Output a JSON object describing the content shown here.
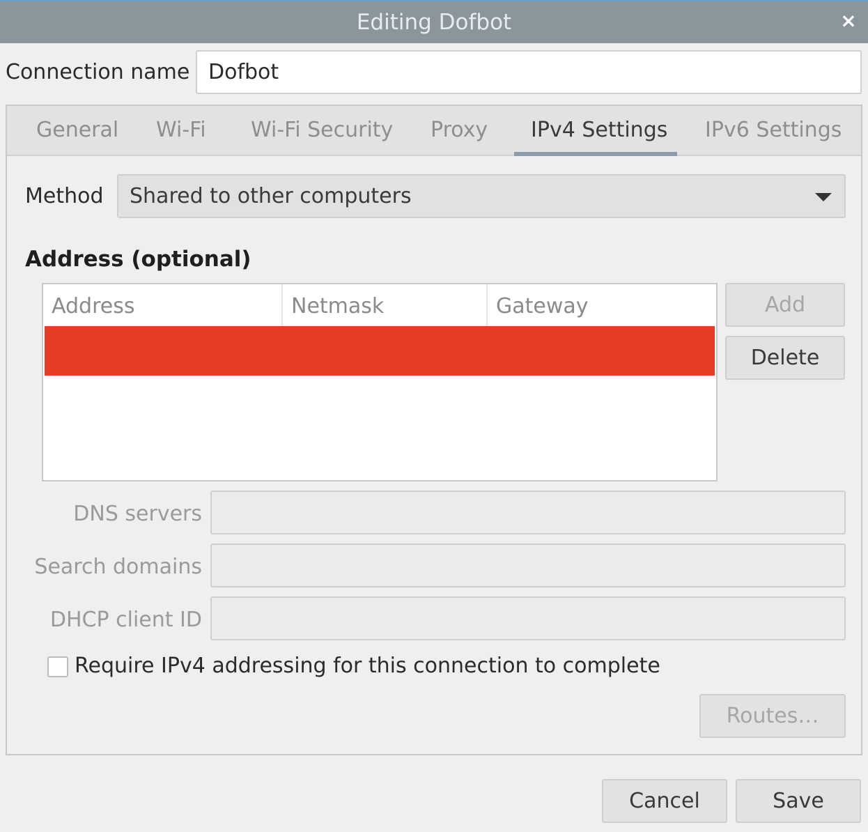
{
  "window": {
    "title": "Editing Dofbot",
    "close_glyph": "×"
  },
  "connection": {
    "label": "Connection name",
    "value": "Dofbot"
  },
  "tabs": [
    {
      "label": "General",
      "active": false
    },
    {
      "label": "Wi-Fi",
      "active": false
    },
    {
      "label": "Wi-Fi Security",
      "active": false
    },
    {
      "label": "Proxy",
      "active": false
    },
    {
      "label": "IPv4 Settings",
      "active": true
    },
    {
      "label": "IPv6 Settings",
      "active": false
    }
  ],
  "method": {
    "label": "Method",
    "value": "Shared to other computers"
  },
  "address_section": {
    "title": "Address (optional)",
    "columns": [
      "Address",
      "Netmask",
      "Gateway"
    ],
    "selected_row_color": "#e83d24"
  },
  "buttons": {
    "add": "Add",
    "delete": "Delete",
    "routes": "Routes…",
    "cancel": "Cancel",
    "save": "Save"
  },
  "fields": {
    "dns_servers": {
      "label": "DNS servers",
      "value": ""
    },
    "search_domains": {
      "label": "Search domains",
      "value": ""
    },
    "dhcp_client_id": {
      "label": "DHCP client ID",
      "value": ""
    }
  },
  "require_ipv4": {
    "label": "Require IPv4 addressing for this connection to complete",
    "checked": false
  }
}
